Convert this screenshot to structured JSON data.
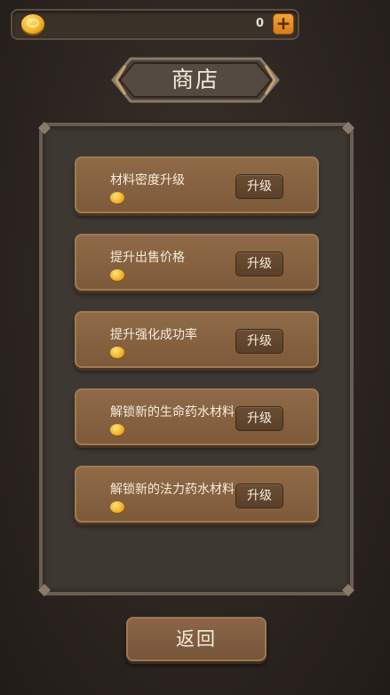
{
  "hud": {
    "coin_icon": "gold-coin-icon",
    "coin_count": "0",
    "add_button_label": "+"
  },
  "title": "商店",
  "shop_items": [
    {
      "label": "材料密度升级",
      "price": "",
      "button": "升级"
    },
    {
      "label": "提升出售价格",
      "price": "",
      "button": "升级"
    },
    {
      "label": "提升强化成功率",
      "price": "",
      "button": "升级"
    },
    {
      "label": "解锁新的生命药水材料",
      "price": "",
      "button": "升级"
    },
    {
      "label": "解锁新的法力药水材料",
      "price": "",
      "button": "升级"
    }
  ],
  "return_label": "返回",
  "colors": {
    "price": "#d41c1c",
    "accent_orange": "#e8921f",
    "item_bg": "#86623f",
    "panel_bg": "#3e3832"
  }
}
